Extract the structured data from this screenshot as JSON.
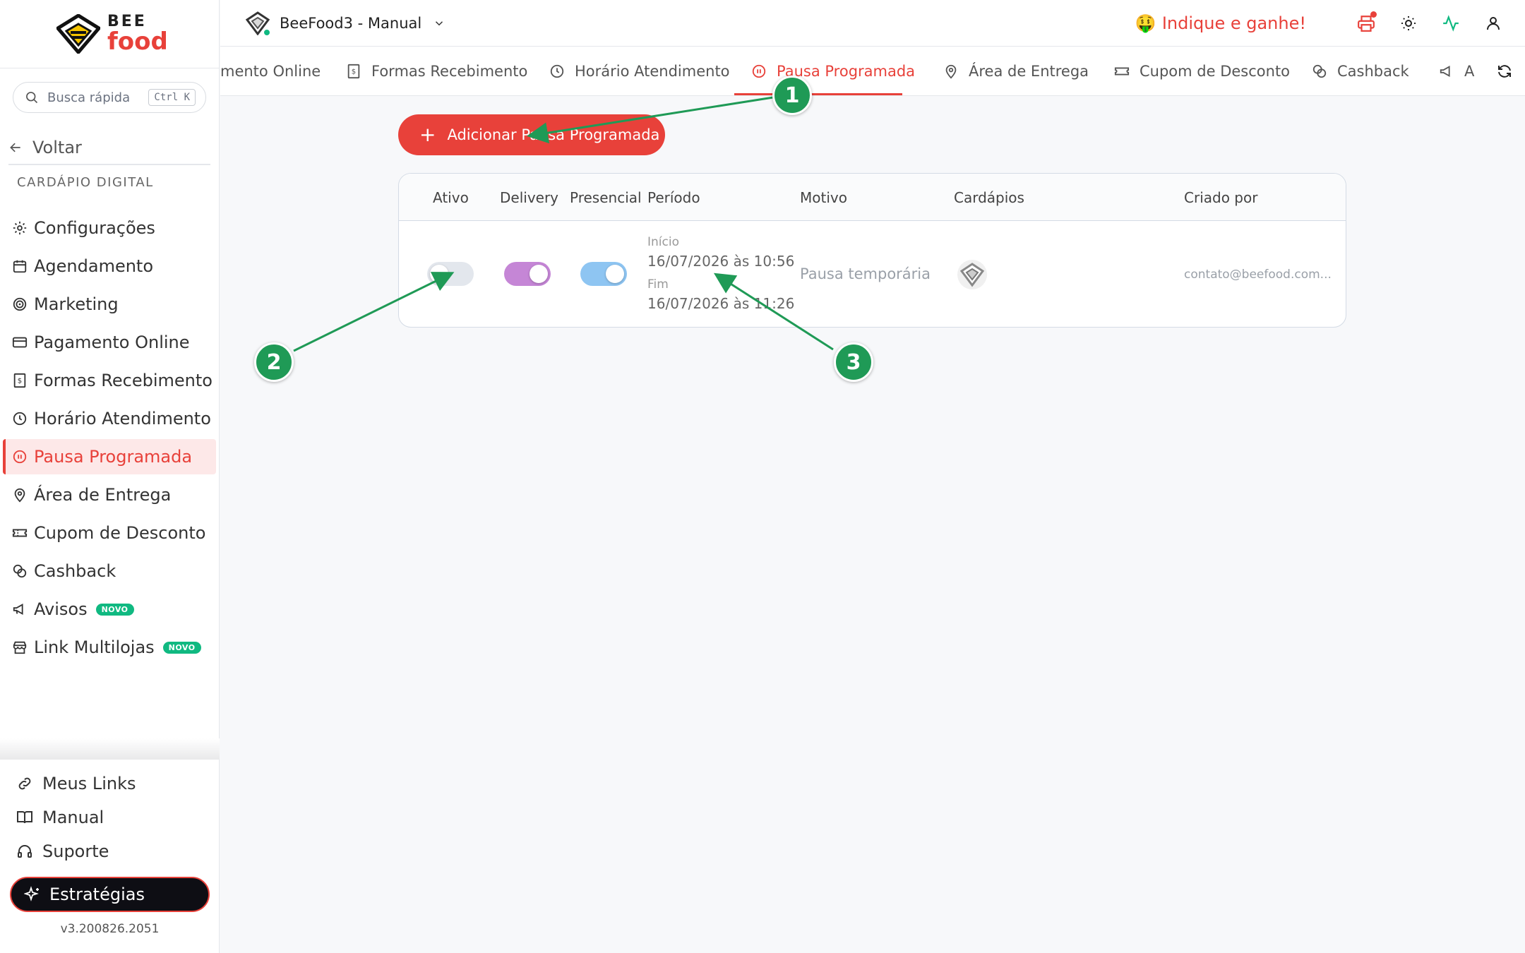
{
  "brand": {
    "line1": "BEE",
    "line2": "food",
    "color": "#e8413a"
  },
  "search": {
    "placeholder": "Busca rápida",
    "shortcut": "Ctrl K"
  },
  "back_label": "Voltar",
  "section_title": "CARDÁPIO DIGITAL",
  "sidebar": {
    "items": [
      {
        "label": "Configurações",
        "icon": "gear-icon"
      },
      {
        "label": "Agendamento",
        "icon": "calendar-icon"
      },
      {
        "label": "Marketing",
        "icon": "target-icon"
      },
      {
        "label": "Pagamento Online",
        "icon": "credit-card-icon"
      },
      {
        "label": "Formas Recebimento",
        "icon": "receipt-icon"
      },
      {
        "label": "Horário Atendimento",
        "icon": "clock-icon"
      },
      {
        "label": "Pausa Programada",
        "icon": "pause-circle-icon",
        "active": true
      },
      {
        "label": "Área de Entrega",
        "icon": "map-pin-icon"
      },
      {
        "label": "Cupom de Desconto",
        "icon": "ticket-icon"
      },
      {
        "label": "Cashback",
        "icon": "coins-icon"
      },
      {
        "label": "Avisos",
        "icon": "megaphone-icon",
        "badge": "NOVO"
      },
      {
        "label": "Link Multilojas",
        "icon": "store-icon",
        "badge": "NOVO"
      }
    ]
  },
  "bottom_links": [
    {
      "label": "Meus Links",
      "icon": "link-icon"
    },
    {
      "label": "Manual",
      "icon": "book-icon"
    },
    {
      "label": "Suporte",
      "icon": "headset-icon"
    }
  ],
  "strategies_label": "Estratégias",
  "version": "v3.200826.2051",
  "topbar": {
    "store_name": "BeeFood3 - Manual",
    "indique_emoji": "🤑",
    "indique_label": "Indique e ganhe!"
  },
  "tabs": [
    {
      "label": "mento Online",
      "icon": ""
    },
    {
      "label": "Formas Recebimento",
      "icon": "receipt-icon"
    },
    {
      "label": "Horário Atendimento",
      "icon": "clock-icon"
    },
    {
      "label": "Pausa Programada",
      "icon": "pause-circle-icon",
      "active": true
    },
    {
      "label": "Área de Entrega",
      "icon": "map-pin-icon"
    },
    {
      "label": "Cupom de Desconto",
      "icon": "ticket-icon"
    },
    {
      "label": "Cashback",
      "icon": "coins-icon"
    },
    {
      "label": "A",
      "icon": "megaphone-icon"
    }
  ],
  "add_button_label": "Adicionar Pausa Programada",
  "table": {
    "headers": {
      "ativo": "Ativo",
      "delivery": "Delivery",
      "presencial": "Presencial",
      "periodo": "Período",
      "motivo": "Motivo",
      "cardapios": "Cardápios",
      "criado_por": "Criado por"
    },
    "rows": [
      {
        "ativo": false,
        "delivery": true,
        "presencial": true,
        "inicio_label": "Início",
        "inicio": "16/07/2026 às 10:56",
        "fim_label": "Fim",
        "fim": "16/07/2026 às 11:26",
        "motivo": "Pausa temporária",
        "criado_por": "contato@beefood.com..."
      }
    ]
  },
  "annotations": [
    "1",
    "2",
    "3"
  ],
  "colors": {
    "accent": "#e8413a",
    "success": "#10b981",
    "annotation": "#1f9a56"
  }
}
